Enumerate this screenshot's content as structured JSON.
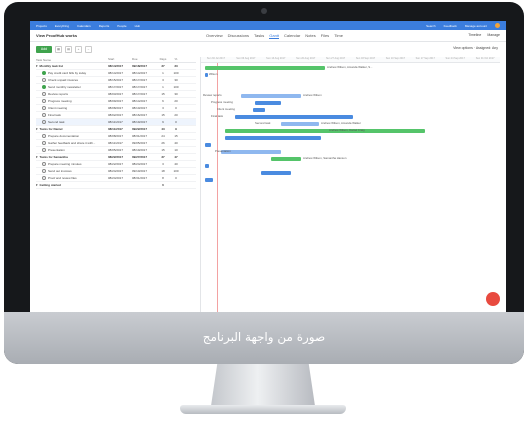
{
  "overlay_caption": "صورة من واجهة البرنامج",
  "nav": {
    "items": [
      "Projects",
      "Everything",
      "Calendars",
      "Reports",
      "People",
      "Hub"
    ],
    "right_items": [
      "Search",
      "Feedback",
      "Manage account"
    ]
  },
  "project": {
    "title": "View ProofHub works",
    "tabs": [
      "Overview",
      "Discussions",
      "Tasks",
      "Gantt",
      "Calendar",
      "Notes",
      "Files",
      "Time"
    ],
    "active_tab": "Gantt",
    "right_links": [
      "Timeline",
      "Manage"
    ]
  },
  "toolbar": {
    "add_label": "Add",
    "view_options": "View options",
    "assigned": "Assigned: Any"
  },
  "columns": {
    "name": "Task Name",
    "start": "Start",
    "due": "Due",
    "days": "Days",
    "pct": "%"
  },
  "tasks": [
    {
      "name": "Monthly task list",
      "start": "08/14/2017",
      "due": "09/18/2017",
      "days": "37",
      "pct": "33",
      "type": "group",
      "done": false
    },
    {
      "name": "Pay credit card bills by today",
      "start": "08/14/2017",
      "due": "08/14/2017",
      "days": "1",
      "pct": "100",
      "type": "task",
      "done": true
    },
    {
      "name": "Check unpaid invoices",
      "start": "08/15/2017",
      "due": "08/17/2017",
      "days": "3",
      "pct": "30",
      "type": "task",
      "done": false
    },
    {
      "name": "Send monthly newsletter",
      "start": "08/17/2017",
      "due": "08/17/2017",
      "days": "1",
      "pct": "100",
      "type": "task",
      "done": true
    },
    {
      "name": "Review reports",
      "start": "08/03/2017",
      "due": "08/17/2017",
      "days": "15",
      "pct": "30",
      "type": "task",
      "done": false
    },
    {
      "name": "Progress meeting",
      "start": "08/09/2017",
      "due": "08/14/2017",
      "days": "6",
      "pct": "20",
      "type": "task",
      "done": false
    },
    {
      "name": "Client meeting",
      "start": "08/08/2017",
      "due": "08/10/2017",
      "days": "3",
      "pct": "0",
      "type": "task",
      "done": false
    },
    {
      "name": "Final task",
      "start": "08/02/2017",
      "due": "08/16/2017",
      "days": "15",
      "pct": "20",
      "type": "task",
      "done": false
    },
    {
      "name": "Second task",
      "start": "08/11/2017",
      "due": "08/19/2017",
      "days": "9",
      "pct": "0",
      "type": "task",
      "done": false
    },
    {
      "name": "Tasks for Daniel",
      "start": "08/11/2017",
      "due": "09/22/2017",
      "days": "43",
      "pct": "9",
      "type": "group",
      "done": false
    },
    {
      "name": "Prepare documentation",
      "start": "08/08/2017",
      "due": "08/31/2017",
      "days": "24",
      "pct": "15",
      "type": "task",
      "done": false
    },
    {
      "name": "Gather feedback and share it with...",
      "start": "08/11/2017",
      "due": "09/05/2017",
      "days": "26",
      "pct": "40",
      "type": "task",
      "done": false
    },
    {
      "name": "Presentation",
      "start": "08/05/2017",
      "due": "08/19/2017",
      "days": "15",
      "pct": "10",
      "type": "task",
      "done": false
    },
    {
      "name": "Tasks for Samantha",
      "start": "08/22/2017",
      "due": "09/27/2017",
      "days": "37",
      "pct": "47",
      "type": "group",
      "done": false
    },
    {
      "name": "Prepare meeting minutes",
      "start": "08/22/2017",
      "due": "08/24/2017",
      "days": "3",
      "pct": "40",
      "type": "task",
      "done": false
    },
    {
      "name": "Send out invoices",
      "start": "08/24/2017",
      "due": "09/10/2017",
      "days": "18",
      "pct": "100",
      "type": "task",
      "done": false
    },
    {
      "name": "Proof and review files",
      "start": "08/24/2017",
      "due": "08/31/2017",
      "days": "8",
      "pct": "0",
      "type": "task",
      "done": false
    },
    {
      "name": "Getting started",
      "start": "",
      "due": "",
      "days": "0",
      "pct": "",
      "type": "group",
      "done": false
    }
  ],
  "timeline_labels": [
    "Sun 30 Jul 2017",
    "Sun 06 Aug 2017",
    "Sun 13 Aug 2017",
    "Sun 20 Aug 2017",
    "Sun 27 Aug 2017",
    "Sun 03 Sep 2017",
    "Sun 10 Sep 2017",
    "Sun 17 Sep 2017",
    "Sun 24 Sep 2017",
    "Sun 01 Oct 2017"
  ],
  "bar_labels": {
    "monthly": "Andrew Wilson, Amanda Walker, S...",
    "review": "Review reports",
    "review_assignee": "Andrew Wilson",
    "progress": "Progress meeting",
    "client": "Client meeting",
    "final": "Final task",
    "second": "Second task",
    "second_assignee": "Andrew Wilson, Amanda Walker",
    "daniel": "Andrew Wilson, Daniel Craig",
    "presentation": "Presentation",
    "samantha": "Andrew Wilson, Samantha Hanson",
    "assignee_top": "Wilson"
  }
}
